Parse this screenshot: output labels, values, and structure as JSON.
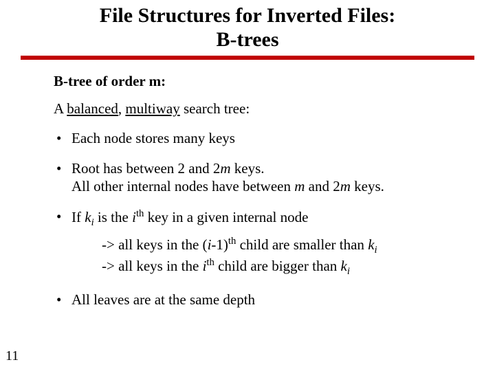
{
  "title_line1": "File Structures for Inverted Files:",
  "title_line2": "B-trees",
  "heading": "B-tree of order m:",
  "intro_prefix": "A ",
  "intro_u1": "balanced",
  "intro_sep": ", ",
  "intro_u2": "multiway",
  "intro_suffix": " search tree:",
  "b1": "Each node stores many keys",
  "b2_a": "Root has between 2 and 2",
  "b2_m1": "m",
  "b2_b": " keys.",
  "b2_c": "All other internal nodes have between ",
  "b2_m2": "m",
  "b2_d": " and 2",
  "b2_m3": "m",
  "b2_e": " keys.",
  "b3_a": "If ",
  "b3_k1": "k",
  "b3_i1": "i",
  "b3_b": " is the ",
  "b3_i2": "i",
  "b3_th1": "th",
  "b3_c": " key in a given internal node",
  "b3_s1a": "-> all keys in the (",
  "b3_s1i": "i",
  "b3_s1b": "-1)",
  "b3_s1th": "th",
  "b3_s1c": " child are smaller than ",
  "b3_s1k": "k",
  "b3_s1ki": "i",
  "b3_s2a": "-> all keys in the ",
  "b3_s2i": "i",
  "b3_s2th": "th",
  "b3_s2b": " child are bigger than ",
  "b3_s2k": "k",
  "b3_s2ki": "i",
  "b4": "All leaves are at the same depth",
  "pagenum": "11"
}
